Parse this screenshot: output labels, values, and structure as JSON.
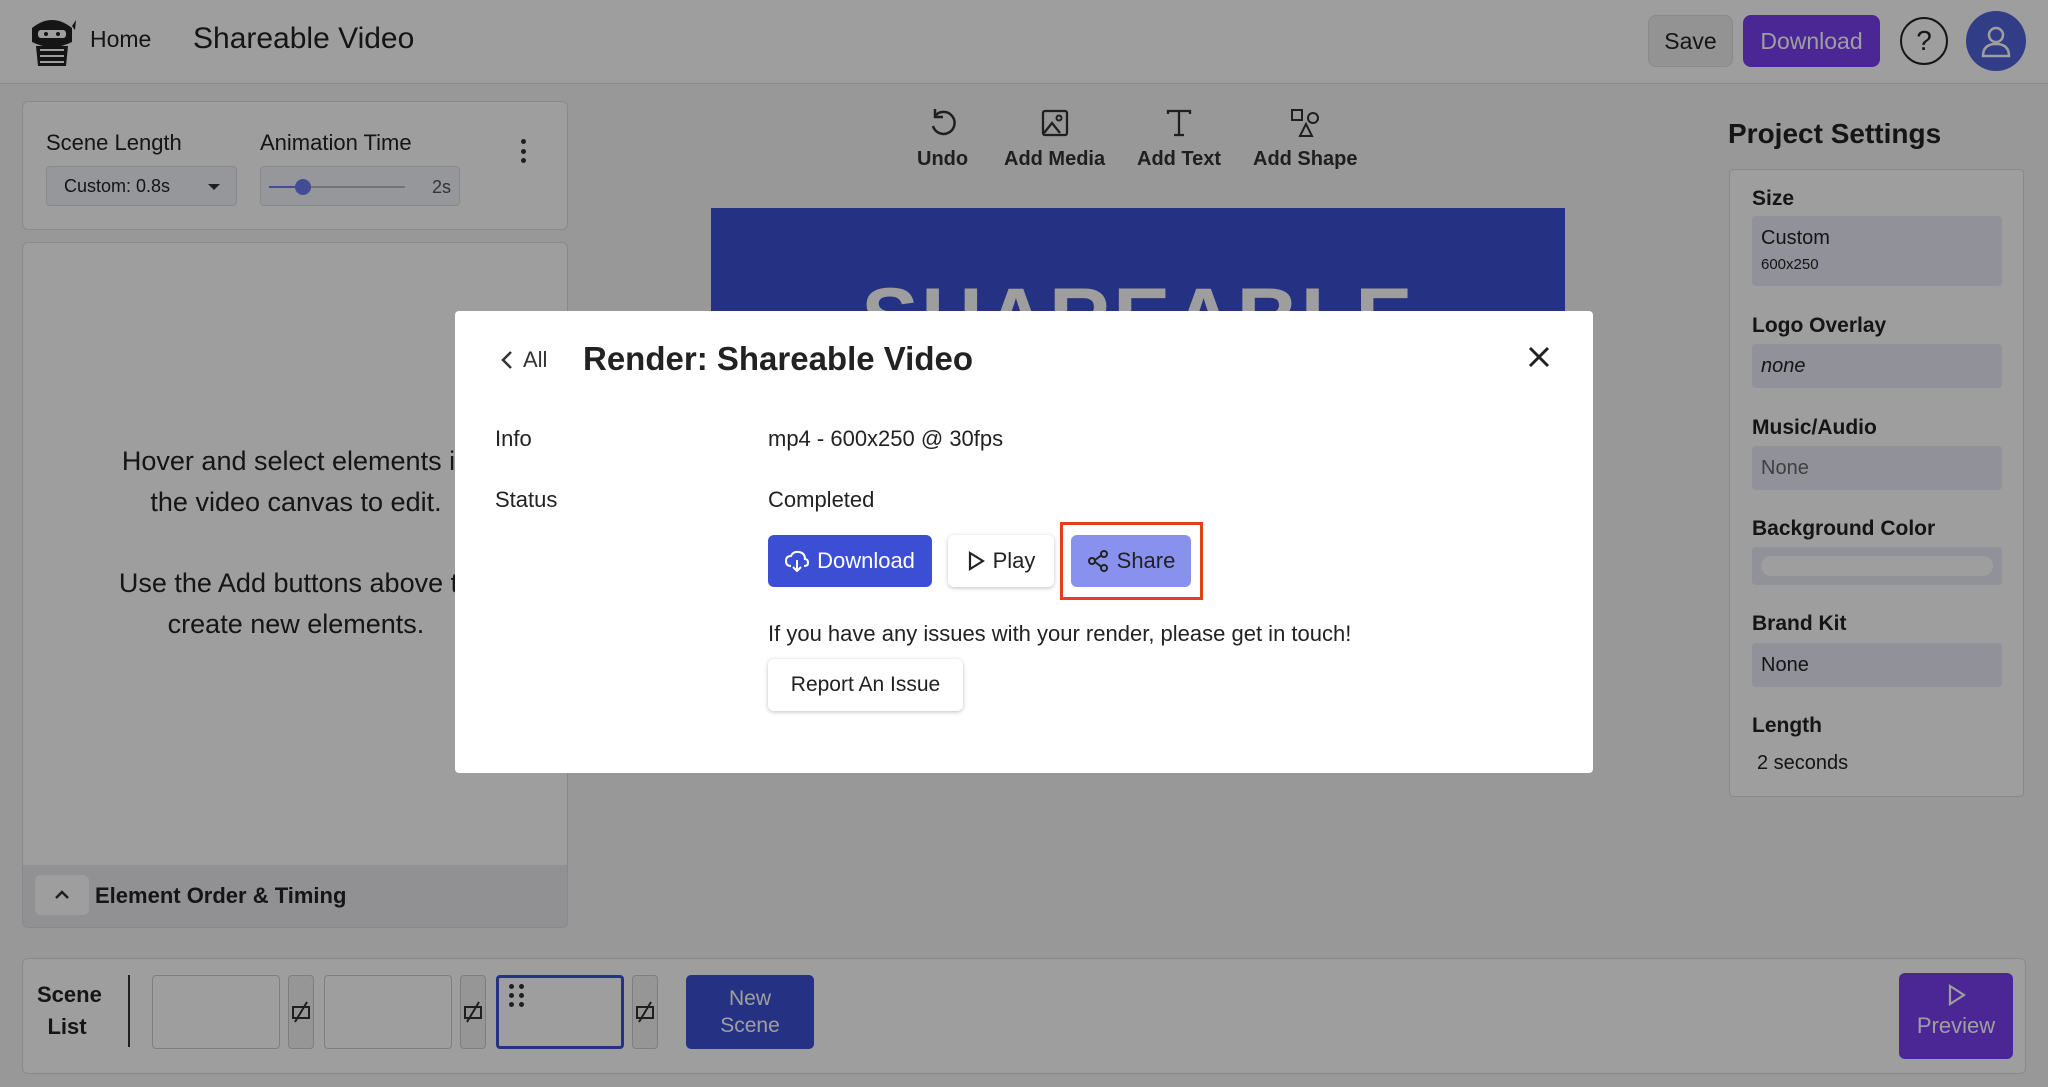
{
  "header": {
    "home_label": "Home",
    "project_title": "Shareable Video",
    "save_label": "Save",
    "download_label": "Download",
    "help_symbol": "?",
    "accent_color": "#7a3ff0"
  },
  "scene_controls": {
    "scene_length_label": "Scene Length",
    "scene_length_value": "Custom: 0.8s",
    "animation_time_label": "Animation Time",
    "animation_time_value": "2s",
    "animation_slider_fraction": 0.25
  },
  "editor_help": {
    "line1": "Hover and select elements in",
    "line2": "the video canvas to edit.",
    "line3": "Use the Add buttons above to",
    "line4": "create new elements.",
    "order_label": "Element Order & Timing"
  },
  "toolbar": {
    "undo": "Undo",
    "add_media": "Add Media",
    "add_text": "Add Text",
    "add_shape": "Add Shape"
  },
  "canvas": {
    "headline": "SHAREABLE",
    "background_color": "#3c4fd4"
  },
  "project_settings": {
    "title": "Project Settings",
    "size_label": "Size",
    "size_value": "Custom",
    "size_dims": "600x250",
    "logo_label": "Logo Overlay",
    "logo_value": "none",
    "music_label": "Music/Audio",
    "music_value": "None",
    "bg_label": "Background Color",
    "brand_label": "Brand Kit",
    "brand_value": "None",
    "length_label": "Length",
    "length_value": "2 seconds"
  },
  "scene_list": {
    "label_line1": "Scene",
    "label_line2": "List",
    "new_scene_line1": "New",
    "new_scene_line2": "Scene",
    "preview_label": "Preview",
    "active_scene_index": 2
  },
  "modal": {
    "back_label": "All",
    "title": "Render: Shareable Video",
    "info_label": "Info",
    "info_value": "mp4 - 600x250 @ 30fps",
    "status_label": "Status",
    "status_value": "Completed",
    "download_label": "Download",
    "play_label": "Play",
    "share_label": "Share",
    "issue_text": "If you have any issues with your render, please get in touch!",
    "report_label": "Report An Issue",
    "highlight_color": "#e2401c"
  }
}
